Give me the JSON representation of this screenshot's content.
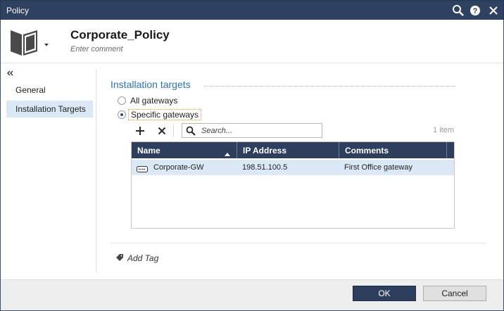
{
  "window": {
    "title": "Policy",
    "icons": [
      "search-icon",
      "help-icon",
      "close-icon"
    ]
  },
  "header": {
    "policy_name": "Corporate_Policy",
    "comment_placeholder": "Enter comment",
    "icon": "policy-book-icon"
  },
  "nav": {
    "collapse_icon": "double-chevron-left-icon",
    "items": [
      {
        "label": "General",
        "active": false
      },
      {
        "label": "Installation Targets",
        "active": true
      }
    ]
  },
  "installation": {
    "title": "Installation targets",
    "options": [
      {
        "label": "All gateways",
        "checked": false
      },
      {
        "label": "Specific gateways",
        "checked": true
      }
    ],
    "toolbar": {
      "add_icon": "plus-icon",
      "remove_icon": "x-icon",
      "search_placeholder": "Search...",
      "item_count": "1 item"
    },
    "table": {
      "columns": [
        "Name",
        "IP Address",
        "Comments"
      ],
      "sort": {
        "column": "Name",
        "direction": "ascending"
      },
      "rows": [
        {
          "icon": "gateway-icon",
          "name": "Corporate-GW",
          "ip": "198.51.100.5",
          "comments": "First Office gateway",
          "selected": true
        }
      ]
    }
  },
  "tags": {
    "add_label": "Add Tag",
    "icon": "tag-icon"
  },
  "buttons": {
    "ok": "OK",
    "cancel": "Cancel"
  },
  "colors": {
    "titlebar": "#2f4160",
    "accent": "#2f73b5",
    "selection": "#dbe9f6",
    "table_header": "#2d3f5c"
  }
}
